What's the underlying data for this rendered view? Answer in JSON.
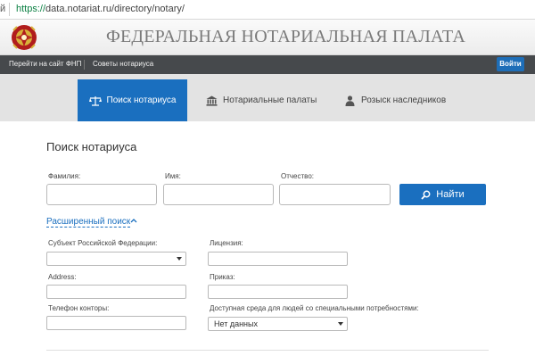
{
  "browser": {
    "left_char": "й",
    "url_https": "https://",
    "url_rest": "data.notariat.ru/directory/notary/"
  },
  "header": {
    "title": "ФЕДЕРАЛЬНАЯ НОТАРИАЛЬНАЯ ПАЛАТА",
    "emblem_icon": "notary-chamber-emblem-icon"
  },
  "topnav": {
    "links": [
      "Перейти на сайт ФНП",
      "Советы нотариуса"
    ],
    "login_label": "Войти"
  },
  "tabs": [
    {
      "label": "Поиск нотариуса",
      "icon": "scales-icon",
      "active": true
    },
    {
      "label": "Нотариальные палаты",
      "icon": "institution-icon",
      "active": false
    },
    {
      "label": "Розыск наследников",
      "icon": "person-icon",
      "active": false
    }
  ],
  "main": {
    "title": "Поиск нотариуса",
    "fields": {
      "surname": "Фамилия:",
      "name": "Имя:",
      "patronymic": "Отчество:"
    },
    "search_button": "Найти",
    "advanced_link": "Расширенный поиск",
    "advanced": {
      "region_label": "Субъект Российской Федерации:",
      "region_value": "",
      "license_label": "Лицензия:",
      "address_label": "Address:",
      "order_label": "Приказ:",
      "phone_label": "Телефон конторы:",
      "accessibility_label": "Доступная среда для людей со специальными потребностями:",
      "accessibility_value": "Нет данных"
    }
  },
  "colors": {
    "accent": "#1a6fbf",
    "nav_dark": "#46494c",
    "tabbar_bg": "#e3e3e3"
  }
}
